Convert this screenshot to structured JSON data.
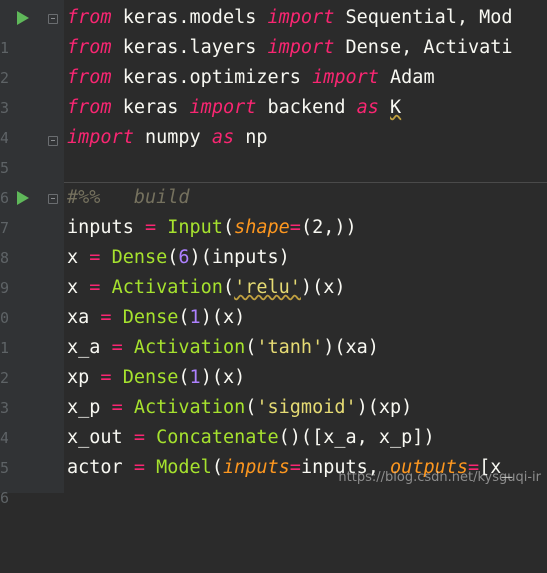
{
  "gutter": {
    "line_numbers": [
      "1",
      "2",
      "3",
      "4",
      "5",
      "6",
      "7",
      "8",
      "9",
      "0",
      "1",
      "2",
      "3",
      "4",
      "5",
      "6"
    ]
  },
  "code": {
    "l1": {
      "kw1": "from",
      "mod": "keras.models",
      "kw2": "import",
      "rest": "Sequential, Mod"
    },
    "l2": {
      "kw1": "from",
      "mod": "keras.layers",
      "kw2": "import",
      "rest": "Dense, Activati"
    },
    "l3": {
      "kw1": "from",
      "mod": "keras.optimizers",
      "kw2": "import",
      "rest": "Adam"
    },
    "l4": {
      "kw1": "from",
      "mod": "keras",
      "kw2": "import",
      "name": "backend",
      "kw3": "as",
      "alias": "K"
    },
    "l5": {
      "kw1": "import",
      "name": "numpy",
      "kw2": "as",
      "alias": "np"
    },
    "l7": {
      "comment": "#%%   build"
    },
    "l8": {
      "var": "inputs",
      "eq": "=",
      "fn": "Input",
      "p1": "(",
      "param": "shape",
      "pe": "=",
      "rest": "(2,))"
    },
    "l9": {
      "var": "x",
      "eq": "=",
      "fn": "Dense",
      "num": "6",
      "rest": "(inputs)"
    },
    "l10": {
      "var": "x",
      "eq": "=",
      "fn": "Activation",
      "str": "'relu'",
      "rest": "(x)"
    },
    "l11": {
      "var": "xa",
      "eq": "=",
      "fn": "Dense",
      "num": "1",
      "rest": "(x)"
    },
    "l12": {
      "var": "x_a",
      "eq": "=",
      "fn": "Activation",
      "str": "'tanh'",
      "rest": "(xa)"
    },
    "l13": {
      "var": "xp",
      "eq": "=",
      "fn": "Dense",
      "num": "1",
      "rest": "(x)"
    },
    "l14": {
      "var": "x_p",
      "eq": "=",
      "fn": "Activation",
      "str": "'sigmoid'",
      "rest": "(xp)"
    },
    "l15": {
      "var": "x_out",
      "eq": "=",
      "fn": "Concatenate",
      "rest": "()([x_a, x_p])"
    },
    "l16": {
      "var": "actor",
      "eq": "=",
      "fn": "Model",
      "p1": "(",
      "param": "inputs",
      "pe": "=",
      "mid": "inputs,",
      "param2": "outputs",
      "pe2": "=",
      "rest": "[x_"
    }
  },
  "watermark": "https://blog.csdn.net/kysguqi-ir",
  "colors": {
    "background": "#2b2b2b",
    "gutter": "#313335",
    "keyword": "#f92672",
    "function": "#a6e22e",
    "number": "#ae81ff",
    "string": "#e6db74",
    "parameter": "#fd971f",
    "comment": "#75715e",
    "run_icon": "#5fb85a"
  }
}
